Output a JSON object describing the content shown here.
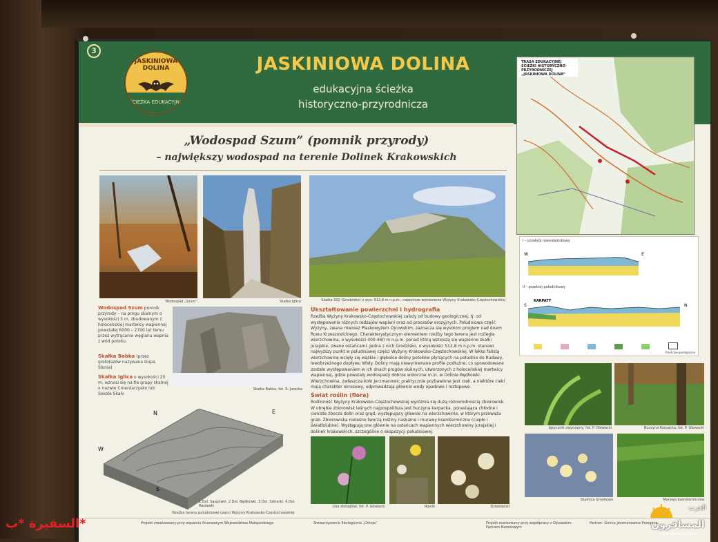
{
  "sign": {
    "number": "3",
    "title": "JASKINIOWA DOLINA",
    "subtitle_line1": "edukacyjna ścieżka",
    "subtitle_line2": "historyczno-przyrodnicza",
    "logo_top": "JASKINIOWA DOLINA",
    "logo_bottom": "ŚCIEŻKA EDUKACYJNA"
  },
  "heading": {
    "line1": "„Wodospad Szum” (pomnik przyrody)",
    "line2": "– największy wodospad na terenie Dolinek Krakowskich"
  },
  "captions": {
    "waterfall": "Wodospad „Szum”",
    "iglica": "Skałka Iglica",
    "hill": "Skałka 502 (Grodzisko) o wys. 512,8 m n.p.m., najwyższe wzniesienie Wyżyny Krakowsko-Częstochowskiej",
    "babka": "Skałka Babka, fot. R. Jurecka",
    "relief": "Rzeźba terenu południowej części Wyżyny Krakowsko-Częstochowskiej",
    "map_title": "TRASA EDUKACYJNEJ ŚCIEŻKI HISTORYCZNO-PRZYRODNICZEJ „JASKINIOWA DOLINA”",
    "profiles": "Przekroje geologiczne",
    "flower1": "Lilia złotogłów, fot. P. Głowacki",
    "flower2": "Rojnik",
    "flower3": "Dziewięćsił",
    "plant1": "Języcznik zwyczajny, fot. P. Głowacki",
    "plant2": "Buczyna Karpacka, fot. P. Głowacki",
    "plant3": "Skalnica Gronkowa",
    "plant4": "Murawa kserotermiczna"
  },
  "left_text": {
    "t1_title": "Wodospad Szum",
    "t1_body": "pomnik przyrody – na progu skalnym o wysokości 5 m, zbudowanym z holoceńskiej martwicy wapiennej powstałej 6000 – 2700 lat temu przez wytrącanie węglanu wapnia z wód potoku.",
    "t2_title": "Skałka Babka",
    "t2_body": "(przez grotołazów nazywana Dupa Słonia)",
    "t3_title": "Skałka Iglica",
    "t3_body": "o wysokości 25 m, wznosi się na tle grupy skalnej o nazwie Cmentarzysko lub Sokole Skały"
  },
  "section1": {
    "title": "Ukształtowanie powierzchni i hydrografia",
    "body": "Rzeźba Wyżyny Krakowsko-Częstochowskiej zależy od budowy geologicznej, tj. od występowania różnych rodzajów wapieni oraz od procesów erozyjnych. Południowa część Wyżyny, zwana również Płaskowyżem Ojcowskim, zaznacza się wysokim progiem nad dnem Rowu Krzeszowickiego. Charakterystycznym elementem rzeźby tego terenu jest rozległa wierzchowina, o wysokości 400-460 m n.p.m. ponad którą wznoszą się wapienne skałki jurajskie, zwane ostańcami. Jedna z nich Grodzisko, o wysokości 512,8 m n.p.m. stanowi najwyższy punkt w południowej części Wyżyny Krakowsko-Częstochowskiej. W lekko falistą wierzchowinę wcięły się wąskie i głębokie doliny potoków płynących na południe do Rudawy, lewobrzeżnego dopływu Wisły. Doliny mają niewyrównane profile podłużne, co spowodowane zostało występowaniem w ich dnach progów skalnych, utworzonych z holoceńskiej martwicy wapiennej, gdzie powstały wodospady dobrze widoczne m.in. w Dolinie Będkowki. Wierzchowina, zwłaszcza koło Jerzmanowic praktycznie pozbawione jest rzek, a niektóre cieki mają charakter okresowy, odprowadzają głównie wody opadowe i roztopowe."
  },
  "section2": {
    "title": "Świat roślin (flora)",
    "body": "Roślinność Wyżyny Krakowsko-Częstochowskiej wyróżnia się dużą różnorodnością zbiorowisk. W obrębie zbiorowisk leśnych najpospolitsza jest buczyna karpacka, porastająca chłodne i cieniste zbocza dolin oraz grąd, występujący głównie na wierzchowinie, w którym przeważa grab. Zbiorowiska nieleśne tworzą rośliny naskalne i murawy kserotermiczne (ciepło i światłolubne). Występują one głównie na ostańcach wapiennych wierzchowiny jurajskiej i dolinek krakowskich, szczególnie o ekspozycji południowej."
  },
  "relief_letters": {
    "n": "N",
    "e": "E",
    "w": "W",
    "s": "S"
  },
  "relief_legend": "1.Dol. Sąspówki, 2.Dol. Będkówki, 3.Dol. Szklarki, 4.Dol. Racławki",
  "profile_labels": {
    "p1": "I – przekrój równoleżnikowy",
    "p2": "II – przekrój południkowy",
    "p1_w": "W",
    "p1_e": "E",
    "p2_s": "S",
    "p2_n": "N",
    "karpaty": "KARPATY"
  },
  "footer": {
    "f1": "Projekt zrealizowany przy wsparciu finansowym Województwa Małopolskiego",
    "f2": "Stowarzyszenie Ekologiczne „Ostoja”",
    "f3": "Projekt realizowany przy współpracy z Ojcowskim Parkiem Narodowym",
    "f4": "Partner: Gmina Jerzmanowice-Przeginia"
  },
  "watermarks": {
    "left": "السفيرة *ب*",
    "right": "المسافرون",
    "right_small": "العرب",
    "url": "www.arabtrvl.com"
  },
  "colors": {
    "header_green": "#2f6b3f",
    "title_yellow": "#f5c84a",
    "section_orange": "#b8502a",
    "watermark_red": "#e41f26"
  }
}
